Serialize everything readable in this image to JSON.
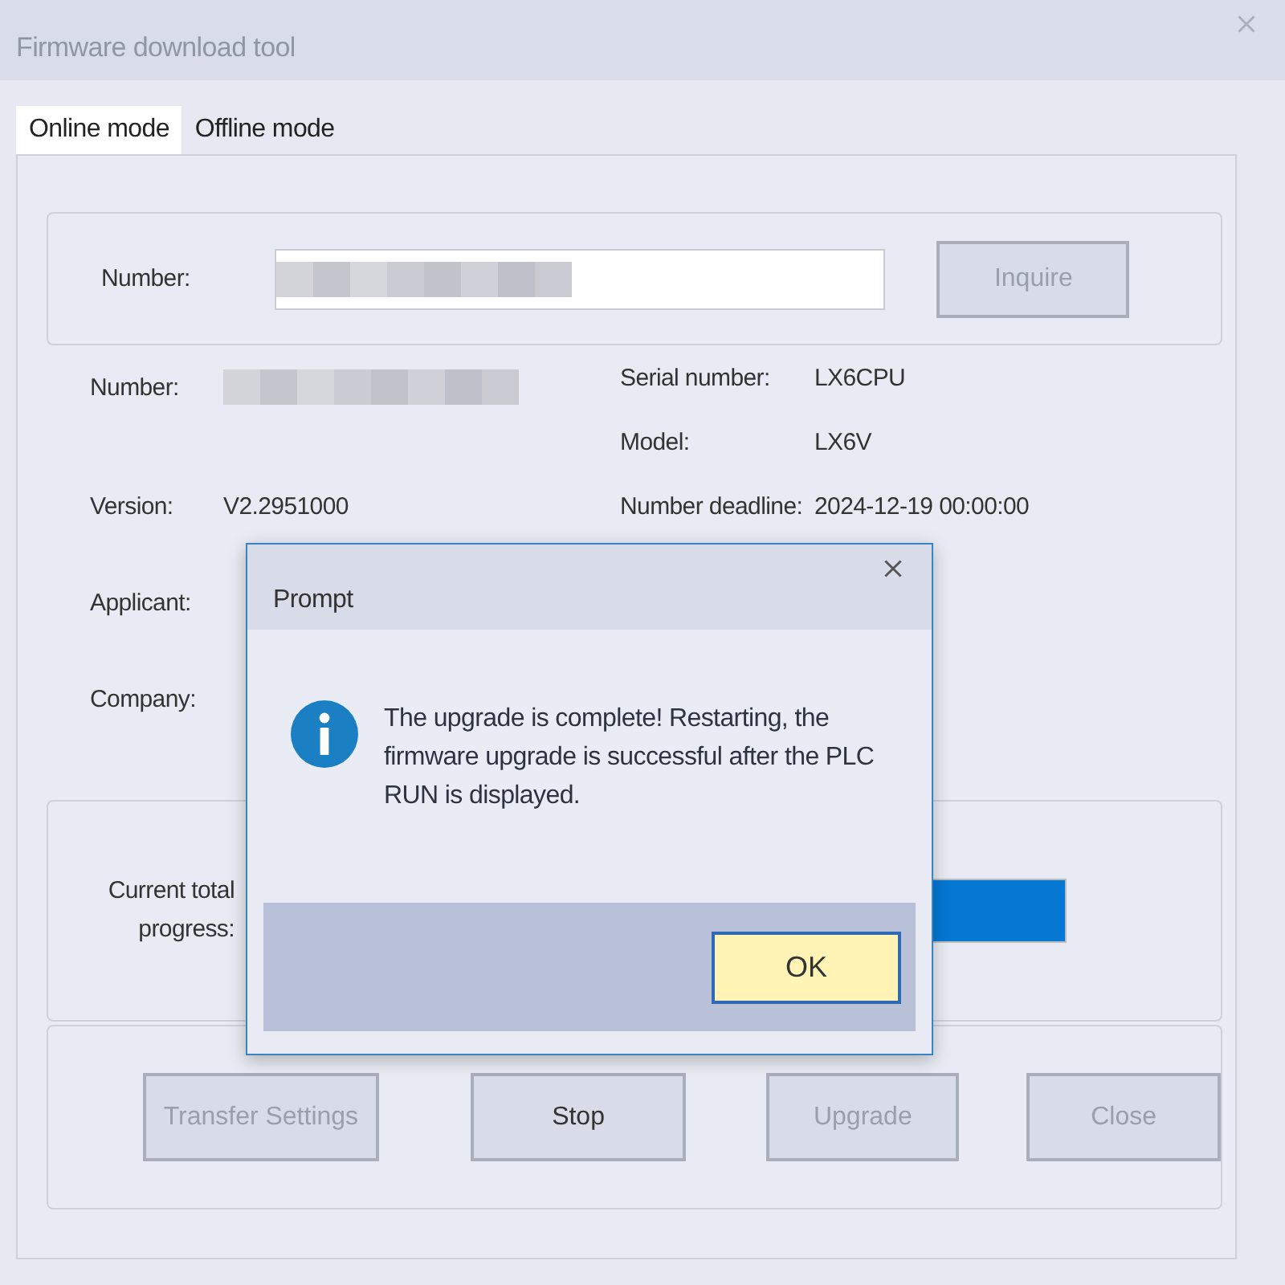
{
  "window": {
    "title": "Firmware download tool"
  },
  "tabs": [
    {
      "label": "Online mode",
      "selected": true
    },
    {
      "label": "Offline mode",
      "selected": false
    }
  ],
  "query": {
    "label": "Number:",
    "button": {
      "label": "Inquire",
      "disabled": true
    }
  },
  "info_left": [
    {
      "label": "Number:",
      "kind": "redacted"
    },
    {
      "label": "Version:",
      "kind": "text",
      "value": "V2.2951000"
    },
    {
      "label": "Applicant:",
      "kind": "empty"
    },
    {
      "label": "Company:",
      "kind": "empty"
    }
  ],
  "info_right": [
    {
      "label": "Serial number:",
      "value": "LX6CPU"
    },
    {
      "label": "Model:",
      "value": "LX6V"
    },
    {
      "label": "Number deadline:",
      "value": "2024-12-19 00:00:00"
    }
  ],
  "progress": {
    "label": "Current total progress:",
    "level": 1
  },
  "buttons": [
    {
      "label": "Transfer Settings",
      "disabled": true
    },
    {
      "label": "Stop",
      "disabled": false
    },
    {
      "label": "Upgrade",
      "disabled": true
    },
    {
      "label": "Close",
      "disabled": true
    }
  ],
  "dialog": {
    "title": "Prompt",
    "message": "The upgrade is complete! Restarting, the firmware upgrade is successful after the PLC RUN is displayed.",
    "button": "OK"
  }
}
